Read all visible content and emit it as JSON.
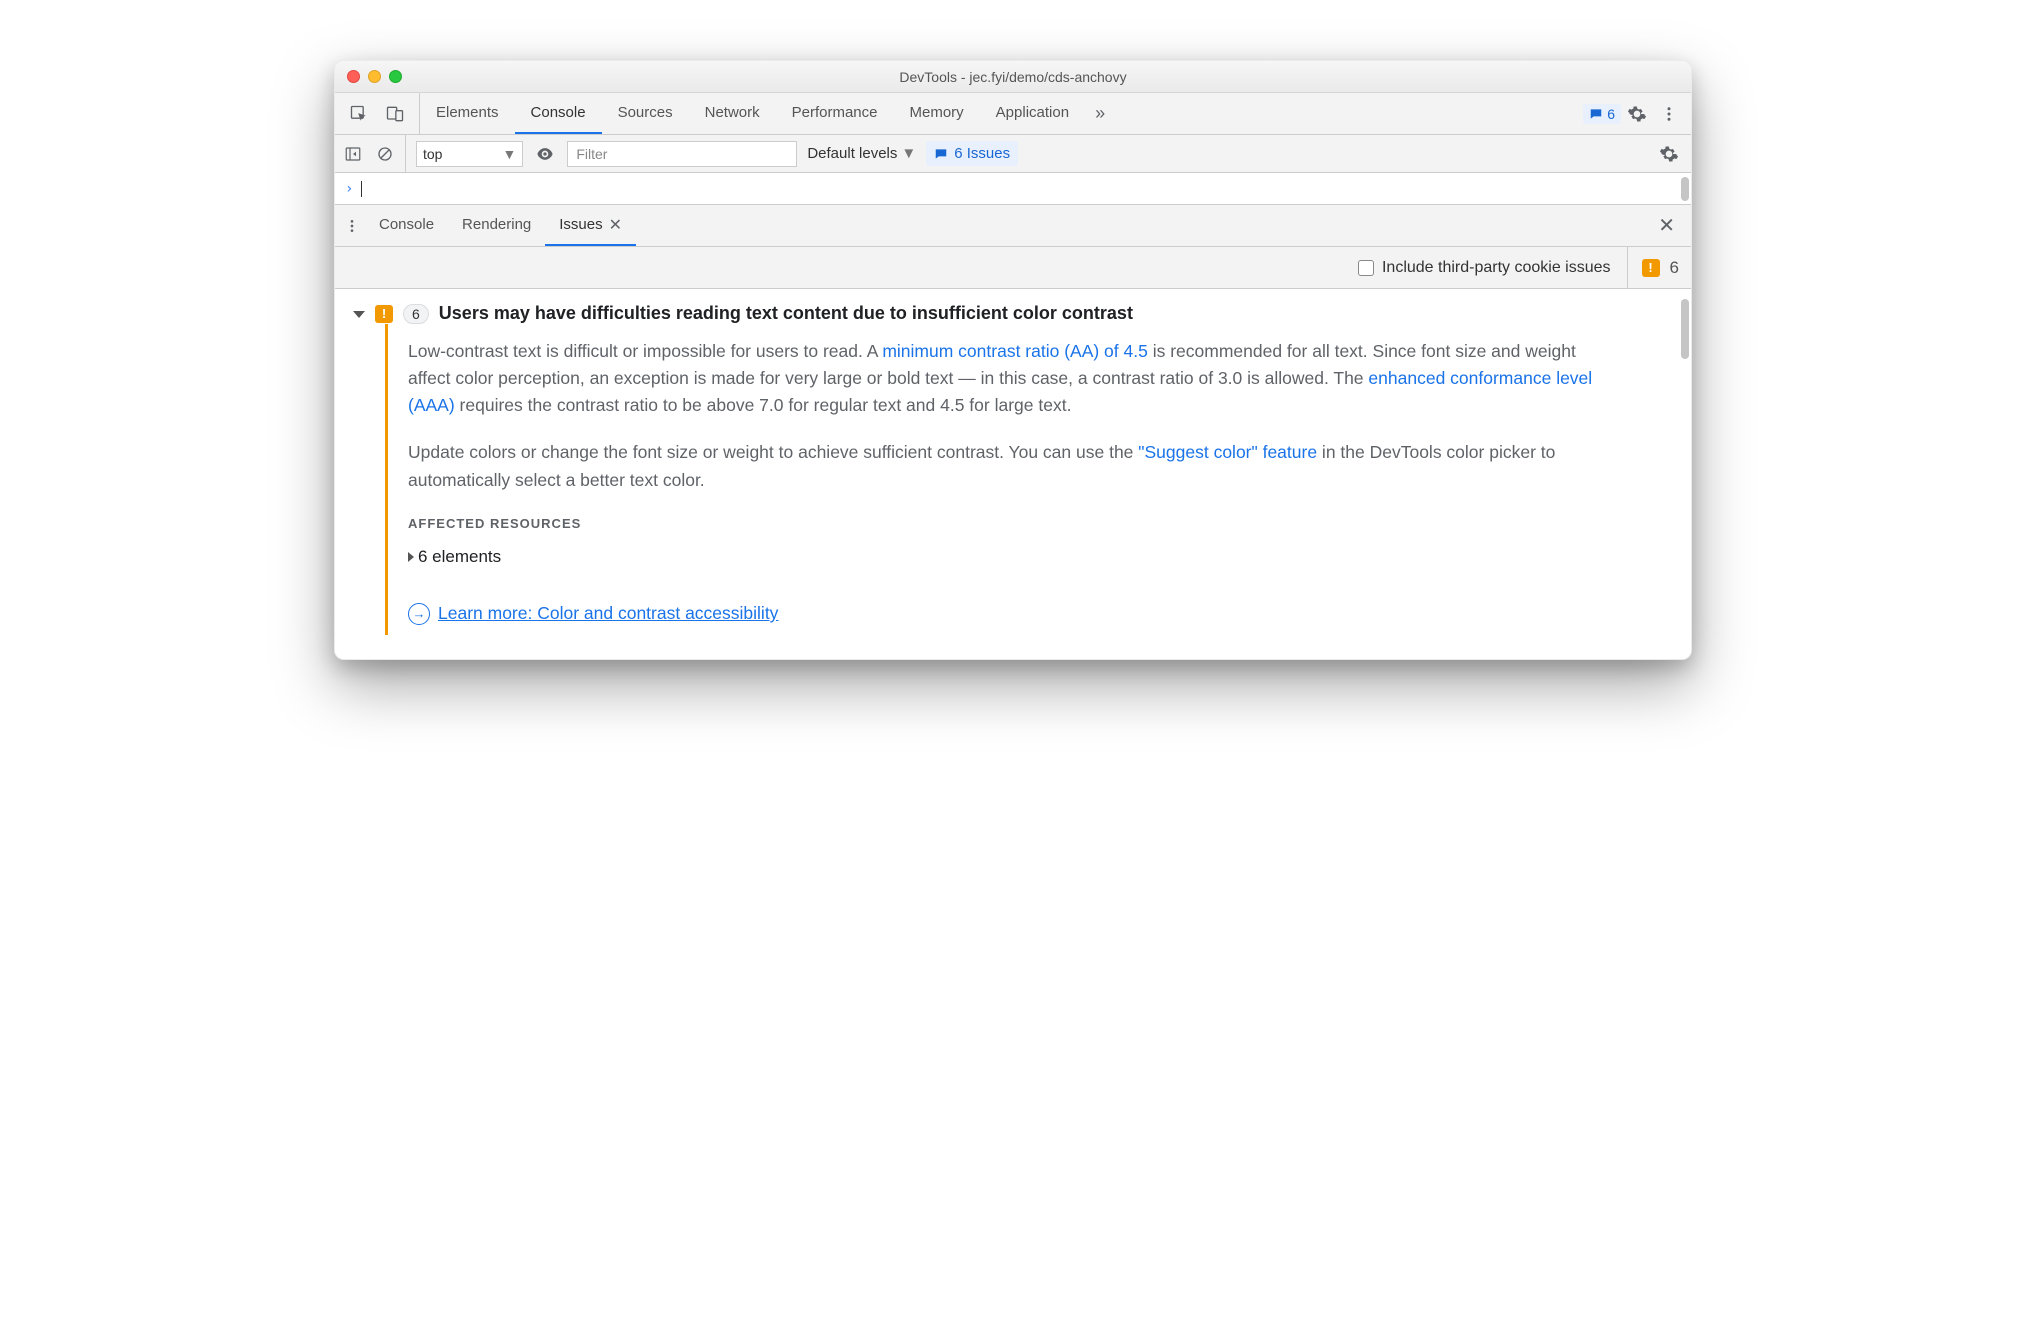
{
  "window": {
    "title": "DevTools - jec.fyi/demo/cds-anchovy"
  },
  "mainTabs": {
    "items": [
      "Elements",
      "Console",
      "Sources",
      "Network",
      "Performance",
      "Memory",
      "Application"
    ],
    "activeIndex": 1,
    "badgeCount": "6"
  },
  "consoleBar": {
    "context": "top",
    "filterPlaceholder": "Filter",
    "levels": "Default levels",
    "issuesLink": "6 Issues"
  },
  "drawer": {
    "tabs": [
      "Console",
      "Rendering",
      "Issues"
    ],
    "activeIndex": 2
  },
  "issuesOptions": {
    "thirdParty": "Include third-party cookie issues",
    "count": "6"
  },
  "issue": {
    "count": "6",
    "title": "Users may have difficulties reading text content due to insufficient color contrast",
    "p1_a": "Low-contrast text is difficult or impossible for users to read. A ",
    "p1_link1": "minimum contrast ratio (AA) of 4.5",
    "p1_b": " is recommended for all text. Since font size and weight affect color perception, an exception is made for very large or bold text — in this case, a contrast ratio of 3.0 is allowed. The ",
    "p1_link2": "enhanced conformance level (AAA)",
    "p1_c": " requires the contrast ratio to be above 7.0 for regular text and 4.5 for large text.",
    "p2_a": "Update colors or change the font size or weight to achieve sufficient contrast. You can use the ",
    "p2_link1": "\"Suggest color\" feature",
    "p2_b": " in the DevTools color picker to automatically select a better text color.",
    "affectedHeading": "Affected Resources",
    "affectedItem": "6 elements",
    "learnMore": "Learn more: Color and contrast accessibility"
  }
}
